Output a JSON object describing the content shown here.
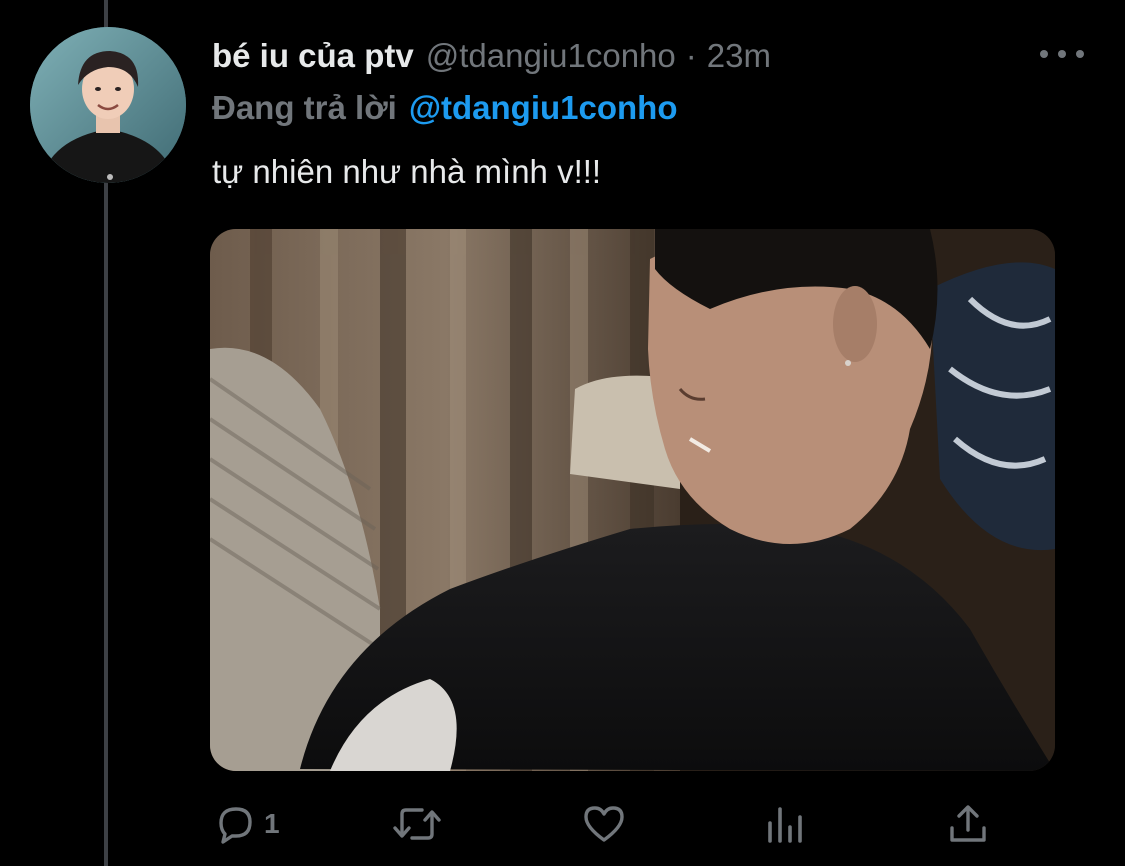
{
  "tweet": {
    "display_name": "bé iu của ptv",
    "handle": "@tdangiu1conho",
    "separator": "·",
    "time": "23m",
    "reply_prefix": "Đang trả lời",
    "reply_to": "@tdangiu1conho",
    "text": "tự nhiên như nhà mình v!!!"
  },
  "actions": {
    "reply": {
      "icon": "comment-icon",
      "count": "1"
    },
    "retweet": {
      "icon": "retweet-icon",
      "count": ""
    },
    "like": {
      "icon": "heart-icon",
      "count": ""
    },
    "views": {
      "icon": "bar-chart-icon",
      "count": ""
    },
    "share": {
      "icon": "share-icon",
      "count": ""
    }
  },
  "colors": {
    "background": "#000000",
    "text": "#e7e9ea",
    "secondary": "#71767b",
    "accent": "#1d9bf0",
    "thread_line": "#3d4045"
  }
}
